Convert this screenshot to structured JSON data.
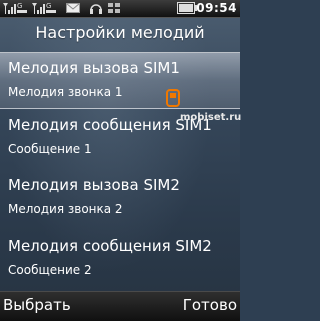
{
  "status": {
    "time": "09:54",
    "icons": [
      "sim1-signal-icon",
      "sim1-network-icon",
      "sim2-signal-icon",
      "sim2-network-icon",
      "message-envelope-icon",
      "headphones-icon",
      "grid-icon",
      "battery-icon"
    ]
  },
  "header": {
    "title": "Настройки мелодий"
  },
  "list": {
    "items": [
      {
        "label": "Мелодия вызова SIM1",
        "value": "Мелодия звонка 1",
        "selected": true
      },
      {
        "label": "Мелодия сообщения SIM1",
        "value": "Сообщение 1",
        "selected": false
      },
      {
        "label": "Мелодия вызова SIM2",
        "value": "Мелодия звонка 2",
        "selected": false
      },
      {
        "label": "Мелодия сообщения SIM2",
        "value": "Сообщение 2",
        "selected": false
      }
    ]
  },
  "watermark": "mobiset.ru",
  "softkeys": {
    "left": "Выбрать",
    "right": "Готово"
  },
  "colors": {
    "background": "#2e3f52",
    "selection": "#9aa3b0",
    "bars": "#111111",
    "accent_phone": "#f07800"
  }
}
